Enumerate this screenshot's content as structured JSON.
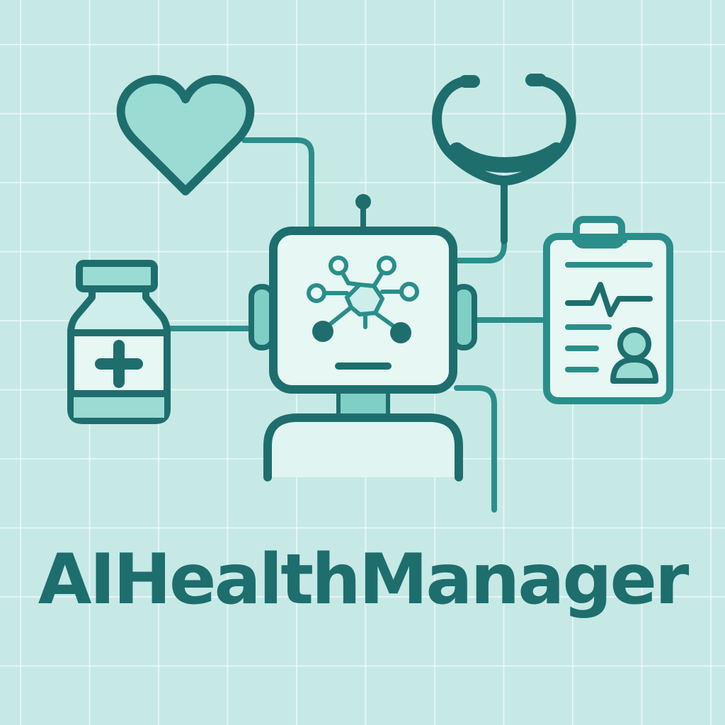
{
  "title": "AIHealthManager",
  "colors": {
    "background": "#C6E9E6",
    "stroke": "#1E6E6E",
    "accent_fill": "#9ADBD3",
    "light_fill": "#E0F5F2"
  },
  "icons": [
    "heart-icon",
    "stethoscope-icon",
    "robot-icon",
    "neural-network-icon",
    "medicine-bottle-icon",
    "medical-clipboard-icon",
    "patient-avatar-icon"
  ]
}
